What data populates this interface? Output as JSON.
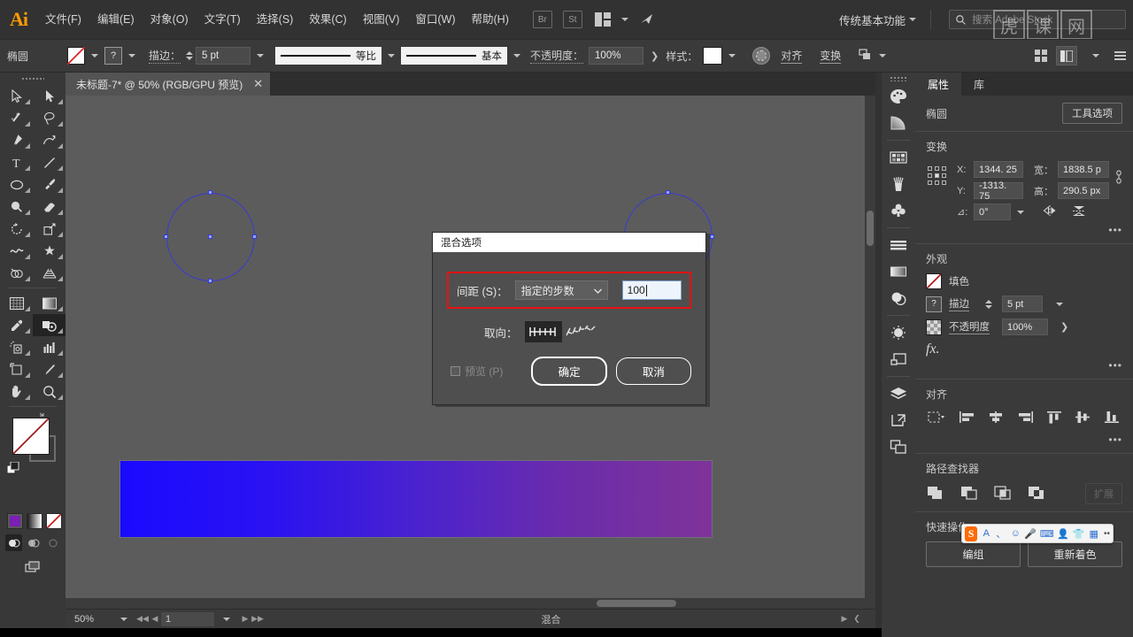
{
  "app": {
    "name": "Ai",
    "workspace": "传统基本功能"
  },
  "menubar": {
    "items": [
      "文件(F)",
      "编辑(E)",
      "对象(O)",
      "文字(T)",
      "选择(S)",
      "效果(C)",
      "视图(V)",
      "窗口(W)",
      "帮助(H)"
    ],
    "bridge_label": "Br",
    "stock_label": "St",
    "search_placeholder": "搜索 Adobe Stock"
  },
  "controlbar": {
    "object_name": "椭圆",
    "fill_swatch": "none-swatch",
    "stroke_swatch_label": "?",
    "stroke_label": "描边：",
    "stroke_weight": "5 pt",
    "profile_label": "等比",
    "brush_label": "基本",
    "opacity_label": "不透明度：",
    "opacity_value": "100%",
    "style_label": "样式：",
    "align_label": "对齐",
    "transform_label": "变换"
  },
  "tabbar": {
    "document_title": "未标题-7* @ 50% (RGB/GPU 预览)",
    "close": "✕"
  },
  "toolbar": {
    "tools": [
      "selection-tool",
      "direct-selection-tool",
      "magic-wand-tool",
      "lasso-tool",
      "pen-tool",
      "curvature-tool",
      "type-tool",
      "line-segment-tool",
      "ellipse-tool",
      "paintbrush-tool",
      "shaper-tool",
      "eraser-tool",
      "rotate-tool",
      "scale-tool",
      "width-tool",
      "free-transform-tool",
      "shape-builder-tool",
      "perspective-grid-tool",
      "mesh-tool",
      "gradient-tool",
      "eyedropper-tool",
      "blend-tool",
      "symbol-sprayer-tool",
      "column-graph-tool",
      "artboard-tool",
      "slice-tool",
      "hand-tool",
      "zoom-tool"
    ],
    "selected_tool": "blend-tool",
    "fill_color": "#ffffff",
    "stroke_color": "none",
    "modes": [
      "color-mode",
      "gradient-mode",
      "none-mode"
    ],
    "draw_modes": [
      "draw-normal",
      "draw-behind",
      "draw-inside"
    ]
  },
  "canvas": {
    "zoom": "50%",
    "shapes": [
      {
        "type": "ellipse",
        "selected": true
      },
      {
        "type": "ellipse",
        "selected": true
      },
      {
        "type": "rectangle",
        "gradient_from": "#1a0aff",
        "gradient_to": "#7f3399"
      }
    ]
  },
  "statusbar": {
    "zoom": "50%",
    "page": "1",
    "tool_status": "混合",
    "nav_first": "◀◀",
    "nav_prev": "◀",
    "nav_next": "▶",
    "nav_last": "▶▶"
  },
  "dock": {
    "icons": [
      "color-icon",
      "gradient-icon",
      "swatches-icon",
      "brushes-icon",
      "symbols-icon",
      "stroke-icon",
      "gradient-panel-icon",
      "transparency-icon",
      "appearance-icon",
      "artboards-icon",
      "layers-icon",
      "links-icon",
      "asset-export-icon"
    ]
  },
  "properties": {
    "tabs": [
      {
        "label": "属性",
        "active": true
      },
      {
        "label": "库",
        "active": false
      }
    ],
    "object_type": "椭圆",
    "tool_options_button": "工具选项",
    "transform": {
      "title": "变换",
      "x_label": "X:",
      "x_value": "1344. 25",
      "y_label": "Y:",
      "y_value": "-1313. 75",
      "w_label": "宽：",
      "w_value": "1838.5 p",
      "h_label": "高：",
      "h_value": "290.5 px",
      "angle_label": "⊿:",
      "angle_value": "0°",
      "flip_h": "flip-horizontal-icon",
      "flip_v": "flip-vertical-icon",
      "more": "•••"
    },
    "appearance": {
      "title": "外观",
      "fill_label": "填色",
      "stroke_label": "描边",
      "stroke_weight": "5 pt",
      "opacity_label": "不透明度",
      "opacity_value": "100%",
      "fx_label": "fx.",
      "more": "•••"
    },
    "align": {
      "title": "对齐",
      "more": "•••"
    },
    "pathfinder": {
      "title": "路径查找器",
      "expand_label": "扩展"
    },
    "quick_actions": {
      "title": "快速操作",
      "buttons": [
        "编组",
        "重新着色"
      ]
    }
  },
  "dialog": {
    "title": "混合选项",
    "spacing_label": "间距 (S)：",
    "spacing_mode": "指定的步数",
    "spacing_value": "100",
    "orientation_label": "取向：",
    "orientation_options": [
      "align-to-page-icon",
      "align-to-path-icon"
    ],
    "preview_label": "预览 (P)",
    "ok_label": "确定",
    "cancel_label": "取消"
  },
  "ime": {
    "brand": "S",
    "tools": [
      "A",
      "、",
      "☺",
      "🎤",
      "⌨",
      "👤",
      "👕",
      "▦"
    ],
    "more": "••"
  },
  "watermark": {
    "chars": [
      "虎",
      "课",
      "网"
    ]
  },
  "colors": {
    "accent_red": "#ee1111",
    "selection_blue": "#3a3ad0",
    "gradient_start": "#1a0aff",
    "gradient_end": "#7f3399",
    "panel_bg": "#3a3a3a",
    "canvas_bg": "#5c5c5c"
  }
}
